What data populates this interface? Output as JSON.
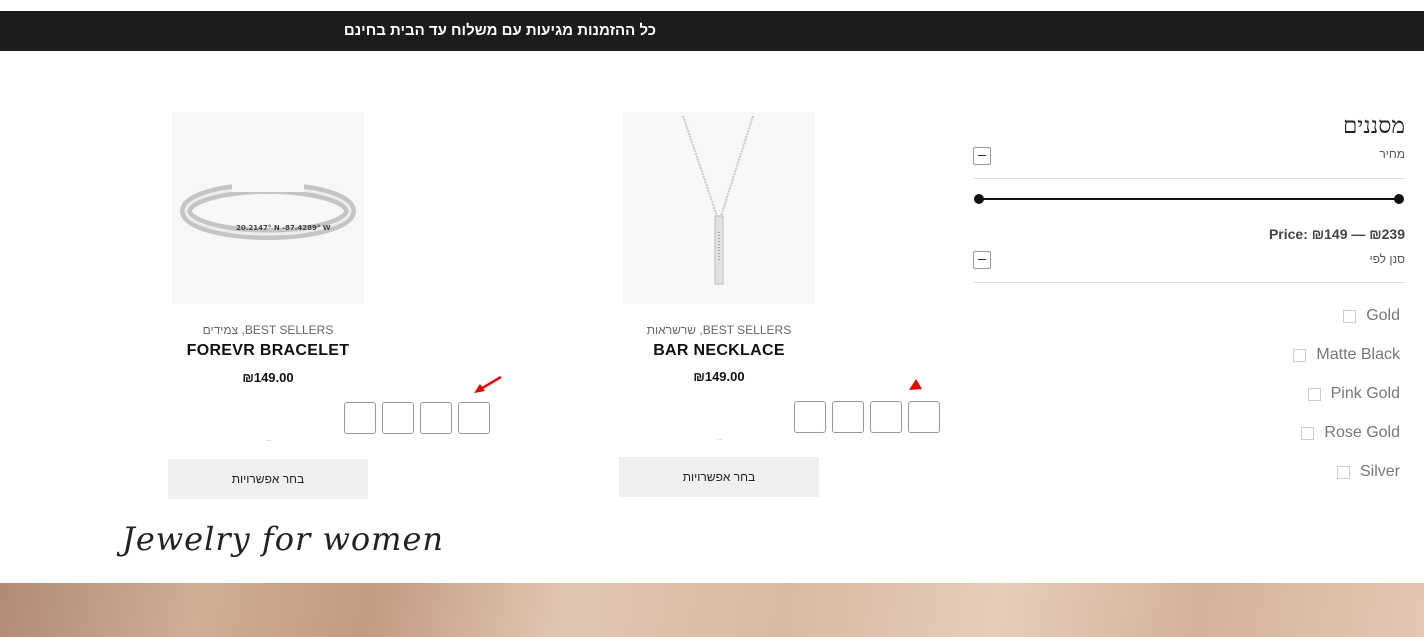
{
  "announcement": {
    "text": "כל ההזמנות מגיעות עם משלוח עד הבית בחינם"
  },
  "filters": {
    "title": "מסננים",
    "price_label": "מחיר",
    "price_range": "Price: ₪149 — ₪239",
    "price_min": 149,
    "price_max": 239,
    "brand_label": "סנן לפי",
    "colors": [
      "Gold",
      "Matte Black",
      "Pink Gold",
      "Rose Gold",
      "Silver"
    ]
  },
  "products": [
    {
      "categories": "BEST SELLERS, צמידים",
      "title": "FOREVR BRACELET",
      "price": "₪149.00",
      "button": "בחר אפשרויות",
      "engraving": "20.2147° N  -87.4289° W"
    },
    {
      "categories": "BEST SELLERS, שרשראות",
      "title": "BAR NECKLACE",
      "price": "₪149.00",
      "button": "בחר אפשרויות"
    }
  ],
  "section": {
    "heading": "Jewelry for women"
  },
  "icons": {
    "collapse": "minus-icon",
    "annotation": "red-arrow-icon"
  },
  "colors": {
    "announcement_bg": "#1c1c1c",
    "arrow": "#e00000",
    "button_bg": "#efefef"
  }
}
